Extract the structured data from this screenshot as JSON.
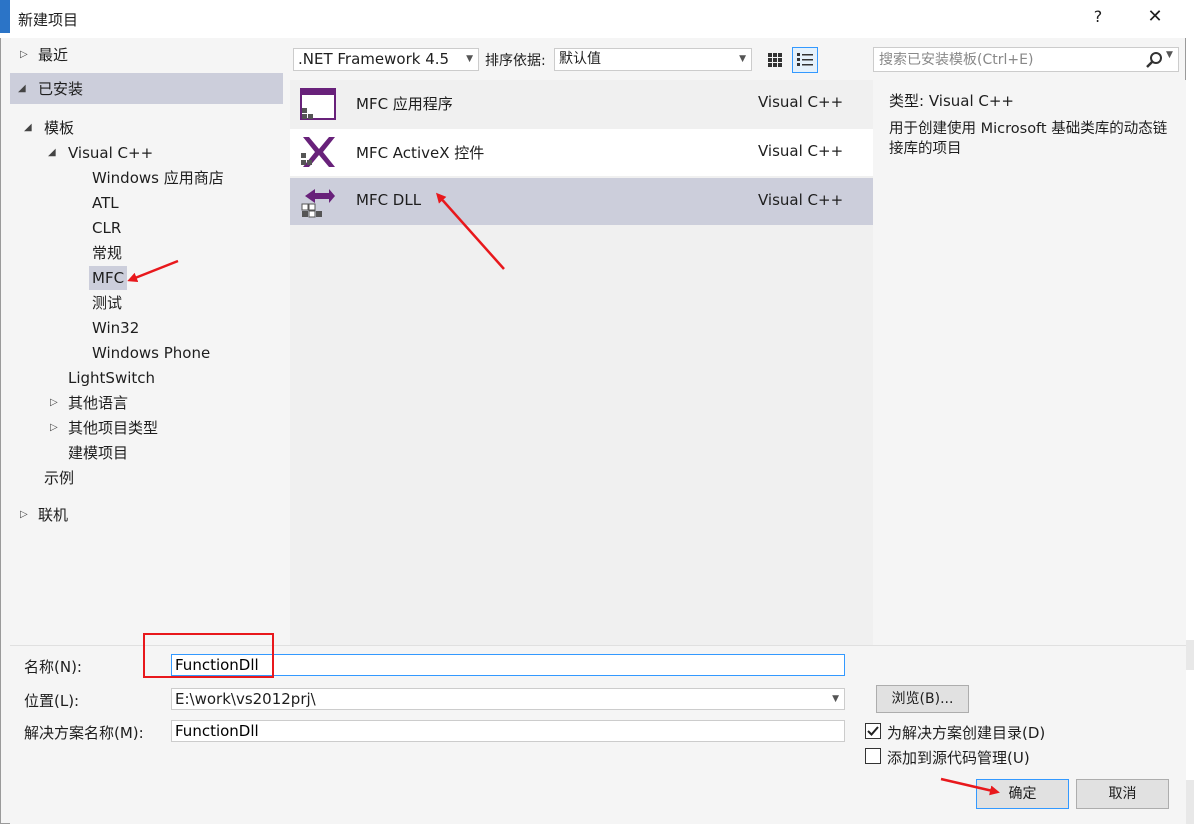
{
  "window": {
    "title": "新建项目",
    "help": "?",
    "close": "✕"
  },
  "tree": {
    "recent": "最近",
    "installed": "已安装",
    "templates": "模板",
    "visual_cpp": "Visual C++",
    "children": [
      "Windows 应用商店",
      "ATL",
      "CLR",
      "常规",
      "MFC",
      "测试",
      "Win32",
      "Windows Phone"
    ],
    "lightswitch": "LightSwitch",
    "other_languages": "其他语言",
    "other_project_types": "其他项目类型",
    "modeling": "建模项目",
    "samples": "示例",
    "online": "联机",
    "selected": "MFC"
  },
  "toolbar": {
    "framework": ".NET Framework 4.5",
    "sort_label": "排序依据:",
    "sort_value": "默认值",
    "view_selected": "list"
  },
  "templates": [
    {
      "name": "MFC 应用程序",
      "lang": "Visual C++",
      "icon": "mfc-app-icon"
    },
    {
      "name": "MFC ActiveX 控件",
      "lang": "Visual C++",
      "icon": "mfc-activex-icon"
    },
    {
      "name": "MFC DLL",
      "lang": "Visual C++",
      "icon": "mfc-dll-icon",
      "selected": true
    }
  ],
  "search": {
    "placeholder": "搜索已安装模板(Ctrl+E)"
  },
  "info": {
    "type_label": "类型:",
    "type_value": "Visual C++",
    "description": "用于创建使用 Microsoft 基础类库的动态链接库的项目"
  },
  "form": {
    "name_label": "名称(N):",
    "name_value": "FunctionDll",
    "location_label": "位置(L):",
    "location_value": "E:\\work\\vs2012prj\\",
    "solution_label": "解决方案名称(M):",
    "solution_value": "FunctionDll",
    "browse": "浏览(B)...",
    "create_dir_label": "为解决方案创建目录(D)",
    "create_dir_checked": true,
    "source_control_label": "添加到源代码管理(U)",
    "source_control_checked": false,
    "ok": "确定",
    "cancel": "取消"
  },
  "colors": {
    "selection": "#cccedb",
    "accent": "#3399ff",
    "mfc_purple": "#68217a",
    "annotation_red": "#e8181c"
  }
}
